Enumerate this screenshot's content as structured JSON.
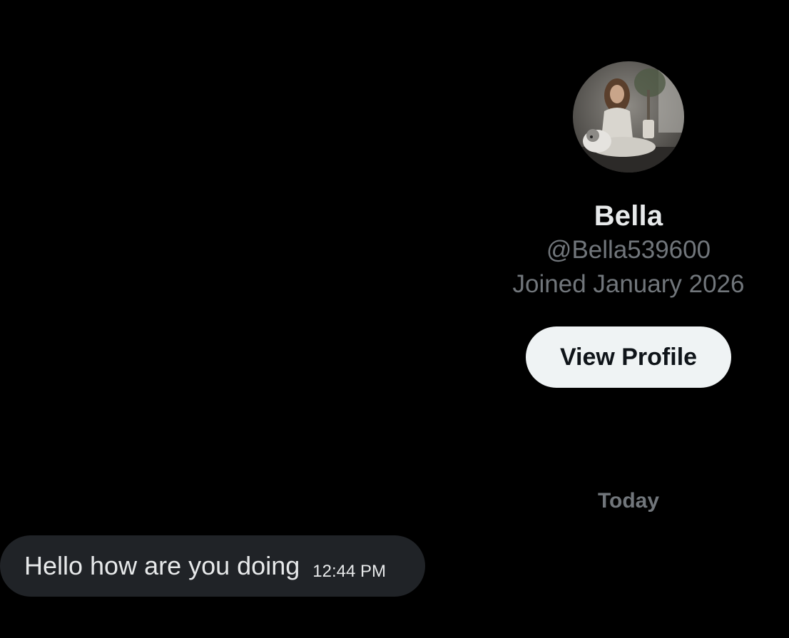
{
  "profile": {
    "avatar_icon": "avatar-photo",
    "name": "Bella",
    "handle": "@Bella539600",
    "joined": "Joined January 2026",
    "view_profile_label": "View Profile"
  },
  "conversation": {
    "date_divider": "Today",
    "messages": [
      {
        "text": "Hello how are you doing",
        "time": "12:44 PM"
      }
    ]
  },
  "colors": {
    "background": "#000000",
    "primary_text": "#e7e9ea",
    "secondary_text": "#71767b",
    "button_bg": "#eff3f4",
    "bubble_bg": "#202327"
  }
}
